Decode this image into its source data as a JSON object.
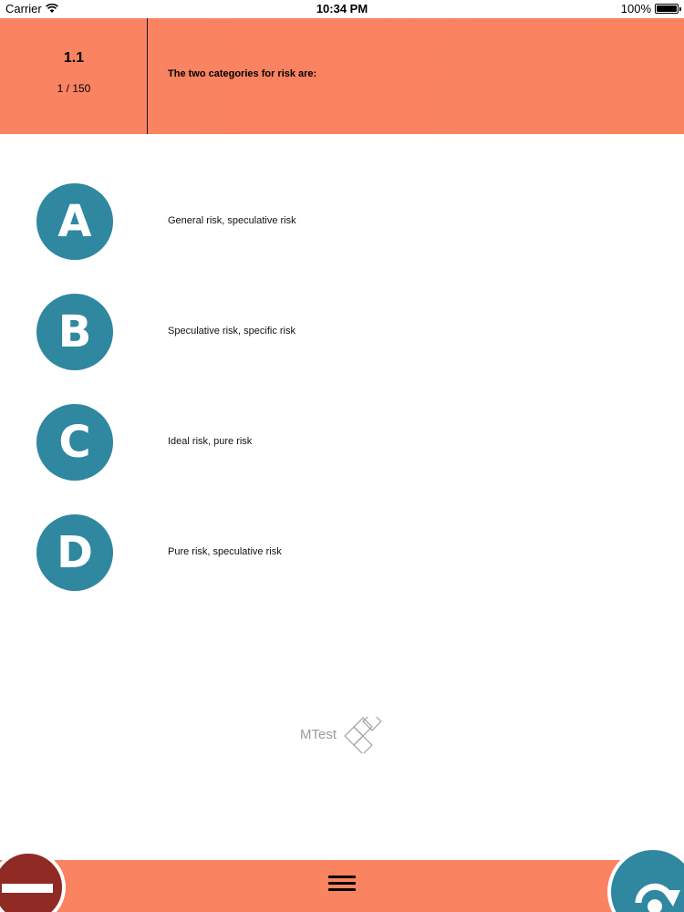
{
  "status_bar": {
    "carrier": "Carrier",
    "time": "10:34 PM",
    "battery": "100%"
  },
  "header": {
    "question_number": "1.1",
    "progress": "1 / 150",
    "question": "The two categories for risk are:"
  },
  "answers": [
    {
      "letter": "A",
      "text": "General risk, speculative risk"
    },
    {
      "letter": "B",
      "text": "Speculative risk, specific risk"
    },
    {
      "letter": "C",
      "text": "Ideal risk, pure risk"
    },
    {
      "letter": "D",
      "text": "Pure risk, speculative risk"
    }
  ],
  "logo": {
    "text": "MTest"
  },
  "colors": {
    "header": "#fa8362",
    "accent": "#2f87a0",
    "stop": "#8f2a24"
  },
  "icons": {
    "menu": "hamburger-icon",
    "stop": "stop-icon",
    "next": "next-arrow-icon",
    "wifi": "wifi-icon",
    "battery": "battery-icon"
  }
}
